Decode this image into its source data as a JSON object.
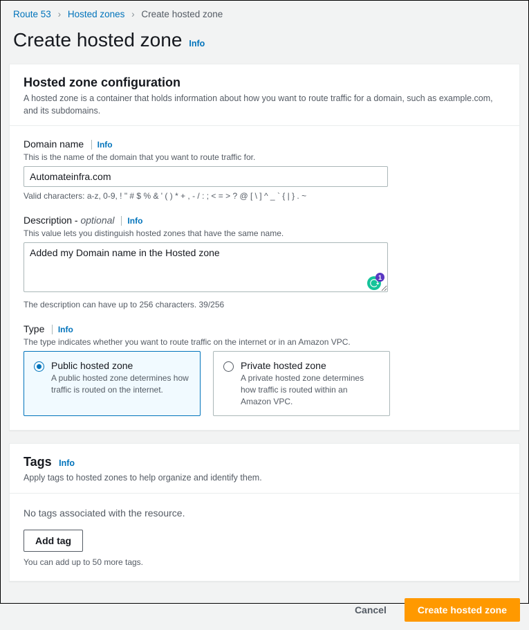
{
  "breadcrumb": {
    "items": [
      {
        "label": "Route 53",
        "href": "#",
        "current": false
      },
      {
        "label": "Hosted zones",
        "href": "#",
        "current": false
      },
      {
        "label": "Create hosted zone",
        "href": "",
        "current": true
      }
    ]
  },
  "page": {
    "title": "Create hosted zone",
    "info": "Info"
  },
  "config": {
    "title": "Hosted zone configuration",
    "description": "A hosted zone is a container that holds information about how you want to route traffic for a domain, such as example.com, and its subdomains.",
    "domain": {
      "label": "Domain name",
      "info": "Info",
      "help": "This is the name of the domain that you want to route traffic for.",
      "value": "Automateinfra.com",
      "hint": "Valid characters: a-z, 0-9, ! \" # $ % & ' ( ) * + , - / : ; < = > ? @ [ \\ ] ^ _ ` { | } . ~"
    },
    "descriptionField": {
      "label_prefix": "Description - ",
      "label_optional": "optional",
      "info": "Info",
      "help": "This value lets you distinguish hosted zones that have the same name.",
      "value": "Added my Domain name in the Hosted zone",
      "counter": "The description can have up to 256 characters. 39/256",
      "grammarly_count": "1"
    },
    "type": {
      "label": "Type",
      "info": "Info",
      "help": "The type indicates whether you want to route traffic on the internet or in an Amazon VPC.",
      "options": [
        {
          "title": "Public hosted zone",
          "sub": "A public hosted zone determines how traffic is routed on the internet.",
          "selected": true
        },
        {
          "title": "Private hosted zone",
          "sub": "A private hosted zone determines how traffic is routed within an Amazon VPC.",
          "selected": false
        }
      ]
    }
  },
  "tags": {
    "title": "Tags",
    "info": "Info",
    "sub": "Apply tags to hosted zones to help organize and identify them.",
    "empty": "No tags associated with the resource.",
    "addButton": "Add tag",
    "limit": "You can add up to 50 more tags."
  },
  "footer": {
    "cancel": "Cancel",
    "submit": "Create hosted zone"
  }
}
